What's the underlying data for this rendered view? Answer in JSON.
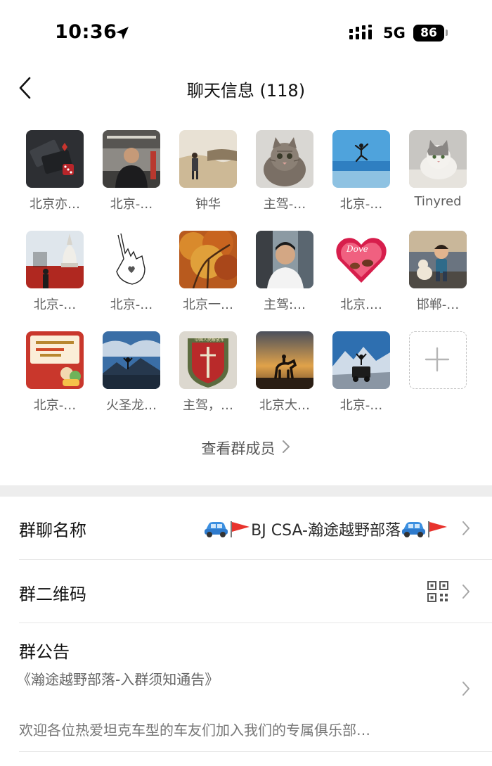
{
  "status_bar": {
    "time": "10:36",
    "network": "5G",
    "battery": "86"
  },
  "nav": {
    "title": "聊天信息 (118)"
  },
  "members": [
    {
      "name": "北京亦…",
      "avatar_icon": "cards-dice-avatar"
    },
    {
      "name": "北京-…",
      "avatar_icon": "man-in-station-avatar"
    },
    {
      "name": "钟华",
      "avatar_icon": "desert-walker-avatar"
    },
    {
      "name": "主驾-…",
      "avatar_icon": "tabby-cat-avatar"
    },
    {
      "name": "北京-…",
      "avatar_icon": "beach-jump-avatar"
    },
    {
      "name": "Tinyred",
      "avatar_icon": "white-cat-avatar"
    },
    {
      "name": "北京-…",
      "avatar_icon": "white-pagoda-avatar"
    },
    {
      "name": "北京-…",
      "avatar_icon": "hand-sketch-avatar"
    },
    {
      "name": "北京一…",
      "avatar_icon": "autumn-tree-avatar"
    },
    {
      "name": "主驾:…",
      "avatar_icon": "man-in-car-avatar"
    },
    {
      "name": "北京.…",
      "avatar_icon": "heart-chocolate-avatar"
    },
    {
      "name": "邯郸-…",
      "avatar_icon": "boy-with-dog-avatar"
    },
    {
      "name": "北京-…",
      "avatar_icon": "red-card-avatar"
    },
    {
      "name": "火圣龙…",
      "avatar_icon": "mountain-lake-avatar"
    },
    {
      "name": "主驾，…",
      "avatar_icon": "military-badge-avatar"
    },
    {
      "name": "北京大…",
      "avatar_icon": "horse-rider-avatar"
    },
    {
      "name": "北京-…",
      "avatar_icon": "jeep-mountain-avatar"
    }
  ],
  "add_member": {
    "icon": "plus-icon"
  },
  "view_members": {
    "label": "查看群成员"
  },
  "group_name": {
    "label": "群聊名称",
    "value": "BJ CSA-瀚途越野部落"
  },
  "qr_code": {
    "label": "群二维码",
    "icon": "qr-code-icon"
  },
  "notice": {
    "label": "群公告",
    "subtitle": "《瀚途越野部落-入群须知通告》",
    "body": "欢迎各位热爱坦克车型的车友们加入我们的专属俱乐部…"
  },
  "colors": {
    "accent_red": "#e8332d",
    "car_blue": "#3b8fe0",
    "divider": "#ededed"
  }
}
